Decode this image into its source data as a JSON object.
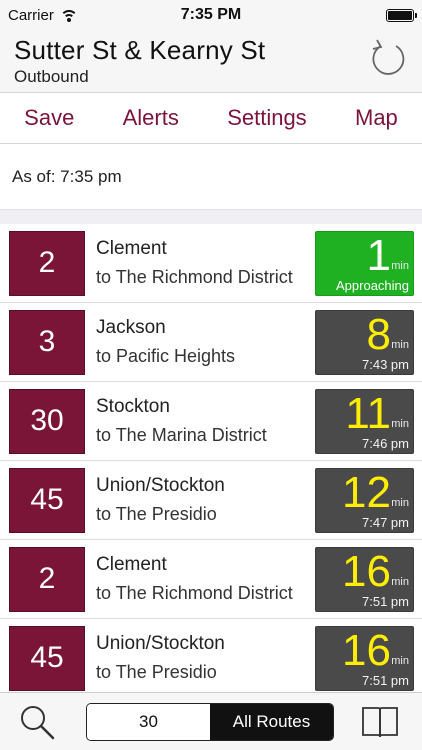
{
  "status": {
    "carrier": "Carrier",
    "time": "7:35 PM"
  },
  "header": {
    "title": "Sutter St & Kearny St",
    "subtitle": "Outbound"
  },
  "toolbar": {
    "save": "Save",
    "alerts": "Alerts",
    "settings": "Settings",
    "map": "Map"
  },
  "asof": "As of: 7:35 pm",
  "colors": {
    "route": "#7a1538",
    "approaching": "#1fb122",
    "prediction": "#4a4a4a",
    "minutes": "#ffee00"
  },
  "arrivals": [
    {
      "route": "2",
      "name": "Clement",
      "dest": "to The Richmond District",
      "mins": "1",
      "unit": "min",
      "time": "Approaching",
      "approaching": true
    },
    {
      "route": "3",
      "name": "Jackson",
      "dest": "to Pacific Heights",
      "mins": "8",
      "unit": "min",
      "time": "7:43 pm",
      "approaching": false
    },
    {
      "route": "30",
      "name": "Stockton",
      "dest": "to The Marina District",
      "mins": "11",
      "unit": "min",
      "time": "7:46 pm",
      "approaching": false
    },
    {
      "route": "45",
      "name": "Union/Stockton",
      "dest": "to The Presidio",
      "mins": "12",
      "unit": "min",
      "time": "7:47 pm",
      "approaching": false
    },
    {
      "route": "2",
      "name": "Clement",
      "dest": "to The Richmond District",
      "mins": "16",
      "unit": "min",
      "time": "7:51 pm",
      "approaching": false
    },
    {
      "route": "45",
      "name": "Union/Stockton",
      "dest": "to The Presidio",
      "mins": "16",
      "unit": "min",
      "time": "7:51 pm",
      "approaching": false
    }
  ],
  "tabbar": {
    "segment_left": "30",
    "segment_right": "All Routes"
  }
}
